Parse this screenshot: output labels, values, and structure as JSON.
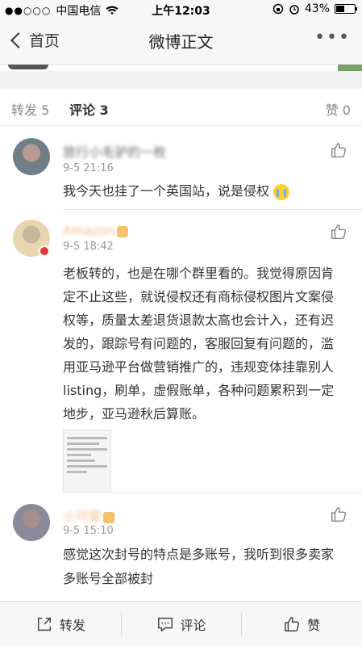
{
  "status_bar": {
    "carrier": "中国电信",
    "time": "上午12:03",
    "battery": "43%"
  },
  "nav": {
    "back_label": "首页",
    "title": "微博正文"
  },
  "tabs": {
    "repost": "转发 5",
    "comment": "评论 3",
    "like": "赞 0"
  },
  "comments": [
    {
      "name": "旅行小毛驴的一枚",
      "time": "9-5 21:16",
      "text": "我今天也挂了一个英国站，说是侵权"
    },
    {
      "name": "Amazon",
      "time": "9-5 18:42",
      "text": "老板转的，也是在哪个群里看的。我觉得原因肯定不止这些，就说侵权还有商标侵权图片文案侵权等，质量太差退货退款太高也会计入，还有迟发的，跟踪号有问题的，客服回复有问题的，滥用亚马逊平台做营销推广的，违规变体挂靠别人listing，刷单，虚假账单，各种问题累积到一定地步，亚马逊秋后算账。"
    },
    {
      "name": "小可爱",
      "time": "9-5 15:10",
      "text": "感觉这次封号的特点是多账号，我听到很多卖家多账号全部被封"
    }
  ],
  "bottom_bar": {
    "repost": "转发",
    "comment": "评论",
    "like": "赞"
  }
}
